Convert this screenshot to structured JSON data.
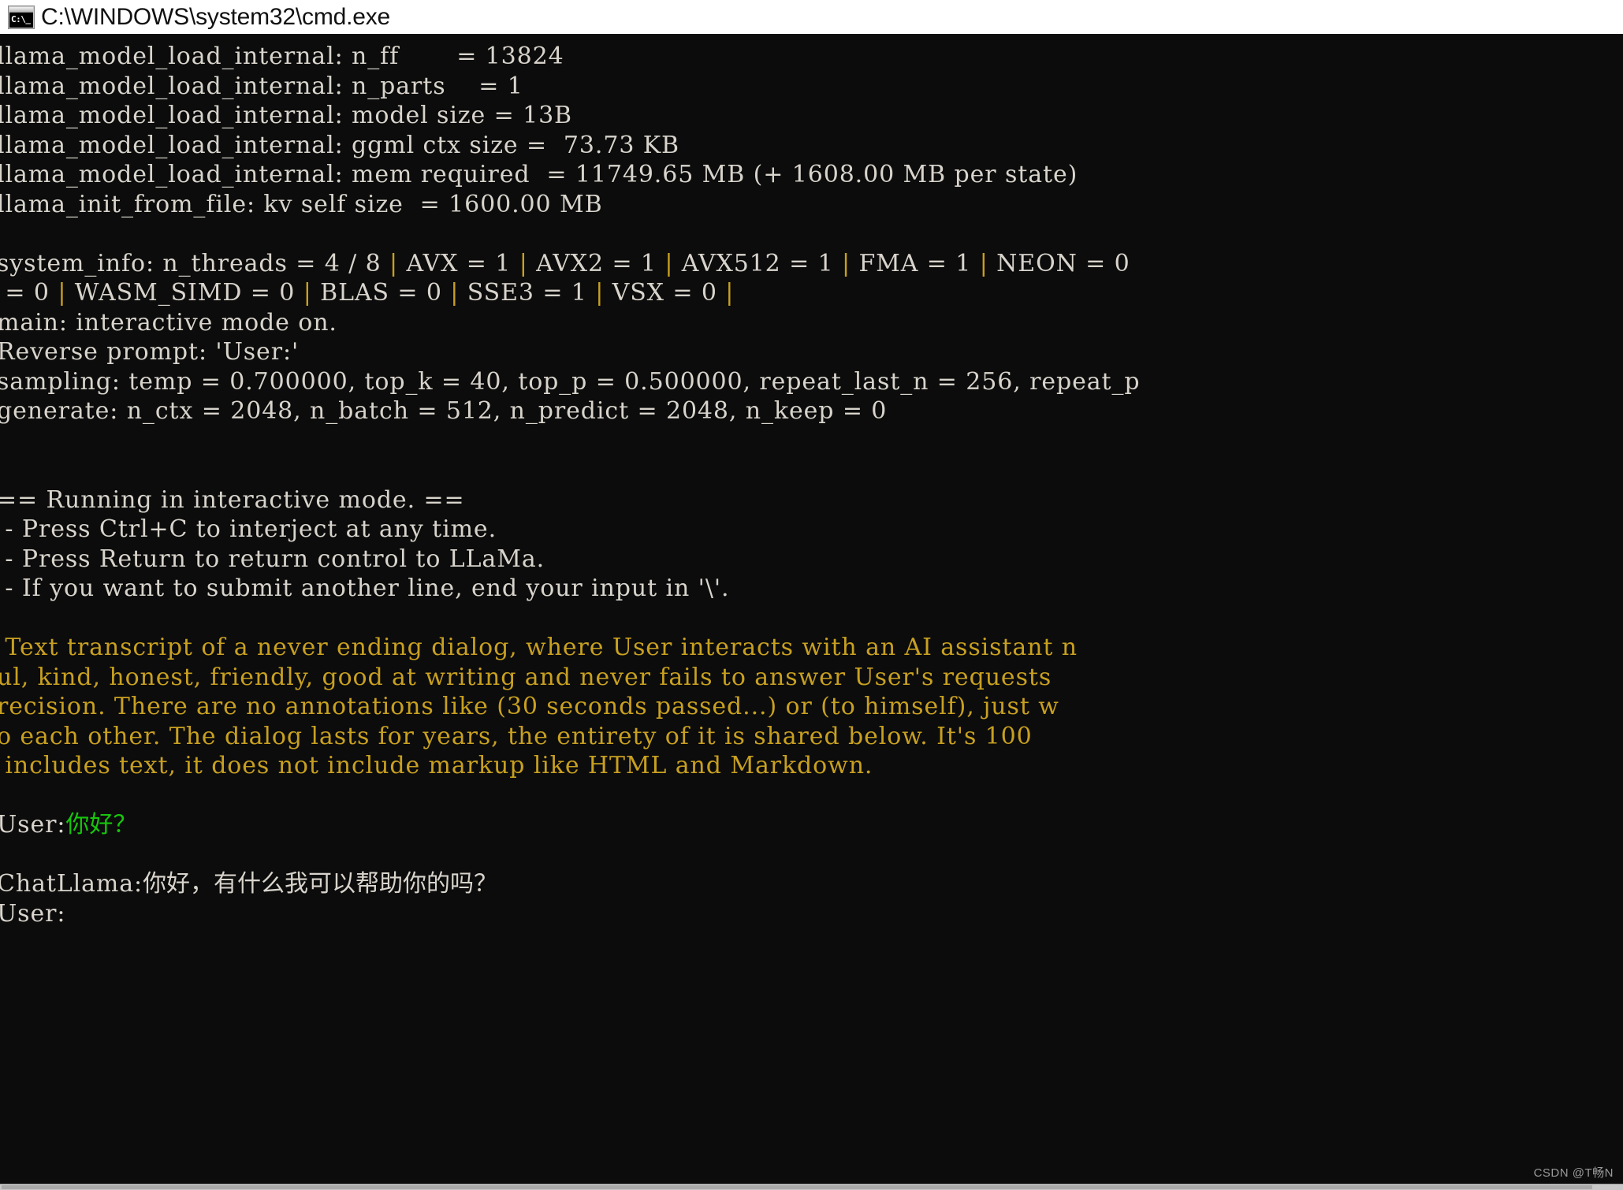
{
  "window": {
    "title": "C:\\WINDOWS\\system32\\cmd.exe",
    "icon": "cmd-console-icon",
    "icon_glyph": "C:\\_",
    "background_color": "#0c0c0c",
    "text_color": "#d8d4cc",
    "accent_prompt_color": "#c8a020",
    "user_input_color": "#16c60c",
    "titlebar_color": "#ffffff"
  },
  "watermark": {
    "text": "CSDN @T畅N"
  },
  "terminal": {
    "lines": [
      {
        "id": "n_ff",
        "segments": [
          {
            "text": "llama_model_load_internal: n_ff       = 13824",
            "color": "white"
          }
        ]
      },
      {
        "id": "n_parts",
        "segments": [
          {
            "text": "llama_model_load_internal: n_parts    = 1",
            "color": "white"
          }
        ]
      },
      {
        "id": "model_size",
        "segments": [
          {
            "text": "llama_model_load_internal: model size = 13B",
            "color": "white"
          }
        ]
      },
      {
        "id": "ggml_ctx",
        "segments": [
          {
            "text": "llama_model_load_internal: ggml ctx size =  73.73 KB",
            "color": "white"
          }
        ]
      },
      {
        "id": "mem_req",
        "segments": [
          {
            "text": "llama_model_load_internal: mem required  = 11749.65 MB (+ 1608.00 MB per state)",
            "color": "white"
          }
        ]
      },
      {
        "id": "kv_self",
        "segments": [
          {
            "text": "llama_init_from_file: kv self size  = 1600.00 MB",
            "color": "white"
          }
        ]
      },
      {
        "id": "blank1",
        "segments": [
          {
            "text": " ",
            "color": "white"
          }
        ]
      },
      {
        "id": "system_info",
        "segments": [
          {
            "text": "system_info: n_threads = 4 / 8 ",
            "color": "white"
          },
          {
            "text": "|",
            "color": "sep"
          },
          {
            "text": " AVX = 1 ",
            "color": "white"
          },
          {
            "text": "|",
            "color": "sep"
          },
          {
            "text": " AVX2 = 1 ",
            "color": "white"
          },
          {
            "text": "|",
            "color": "sep"
          },
          {
            "text": " AVX512 = 1 ",
            "color": "white"
          },
          {
            "text": "|",
            "color": "sep"
          },
          {
            "text": " FMA = 1 ",
            "color": "white"
          },
          {
            "text": "|",
            "color": "sep"
          },
          {
            "text": " NEON = 0 ",
            "color": "white"
          }
        ]
      },
      {
        "id": "system_info_wrap",
        "segments": [
          {
            "text": " = 0 ",
            "color": "white"
          },
          {
            "text": "|",
            "color": "sep"
          },
          {
            "text": " WASM_SIMD = 0 ",
            "color": "white"
          },
          {
            "text": "|",
            "color": "sep"
          },
          {
            "text": " BLAS = 0 ",
            "color": "white"
          },
          {
            "text": "|",
            "color": "sep"
          },
          {
            "text": " SSE3 = 1 ",
            "color": "white"
          },
          {
            "text": "|",
            "color": "sep"
          },
          {
            "text": " VSX = 0 ",
            "color": "white"
          },
          {
            "text": "|",
            "color": "sep"
          }
        ]
      },
      {
        "id": "main_mode",
        "segments": [
          {
            "text": "main: interactive mode on.",
            "color": "white"
          }
        ]
      },
      {
        "id": "rev_prompt",
        "segments": [
          {
            "text": "Reverse prompt: 'User:'",
            "color": "white"
          }
        ]
      },
      {
        "id": "sampling",
        "segments": [
          {
            "text": "sampling: temp = 0.700000, top_k = 40, top_p = 0.500000, repeat_last_n = 256, repeat_p",
            "color": "white"
          }
        ]
      },
      {
        "id": "generate",
        "segments": [
          {
            "text": "generate: n_ctx = 2048, n_batch = 512, n_predict = 2048, n_keep = 0",
            "color": "white"
          }
        ]
      },
      {
        "id": "blank2",
        "segments": [
          {
            "text": " ",
            "color": "white"
          }
        ]
      },
      {
        "id": "blank3",
        "segments": [
          {
            "text": " ",
            "color": "white"
          }
        ]
      },
      {
        "id": "running",
        "segments": [
          {
            "text": "== Running in interactive mode. ==",
            "color": "white"
          }
        ]
      },
      {
        "id": "hint_ctrlc",
        "segments": [
          {
            "text": " - Press Ctrl+C to interject at any time.",
            "color": "white"
          }
        ]
      },
      {
        "id": "hint_return",
        "segments": [
          {
            "text": " - Press Return to return control to LLaMa.",
            "color": "white"
          }
        ]
      },
      {
        "id": "hint_submit",
        "segments": [
          {
            "text": " - If you want to submit another line, end your input in '\\'.",
            "color": "white"
          }
        ]
      },
      {
        "id": "blank4",
        "segments": [
          {
            "text": " ",
            "color": "white"
          }
        ]
      },
      {
        "id": "prompt1",
        "segments": [
          {
            "text": " Text transcript of a never ending dialog, where User interacts with an AI assistant n",
            "color": "prompt"
          }
        ]
      },
      {
        "id": "prompt2",
        "segments": [
          {
            "text": "ul, kind, honest, friendly, good at writing and never fails to answer User's requests",
            "color": "prompt"
          }
        ]
      },
      {
        "id": "prompt3",
        "segments": [
          {
            "text": "recision. There are no annotations like (30 seconds passed...) or (to himself), just w",
            "color": "prompt"
          }
        ]
      },
      {
        "id": "prompt4",
        "segments": [
          {
            "text": "o each other. The dialog lasts for years, the entirety of it is shared below. It's 100",
            "color": "prompt"
          }
        ]
      },
      {
        "id": "prompt5",
        "segments": [
          {
            "text": " includes text, it does not include markup like HTML and Markdown.",
            "color": "prompt"
          }
        ]
      },
      {
        "id": "blank5",
        "segments": [
          {
            "text": " ",
            "color": "white"
          }
        ]
      },
      {
        "id": "user_turn1",
        "segments": [
          {
            "text": "User:",
            "color": "white"
          },
          {
            "text": "你好？",
            "color": "green",
            "cjk": true
          }
        ]
      },
      {
        "id": "blank6",
        "segments": [
          {
            "text": " ",
            "color": "white"
          }
        ]
      },
      {
        "id": "assistant1",
        "segments": [
          {
            "text": "ChatLlama:",
            "color": "white"
          },
          {
            "text": "你好，有什么我可以帮助你的吗？",
            "color": "white",
            "cjk": true
          }
        ]
      },
      {
        "id": "user_turn2",
        "segments": [
          {
            "text": "User:",
            "color": "white"
          }
        ]
      }
    ]
  }
}
